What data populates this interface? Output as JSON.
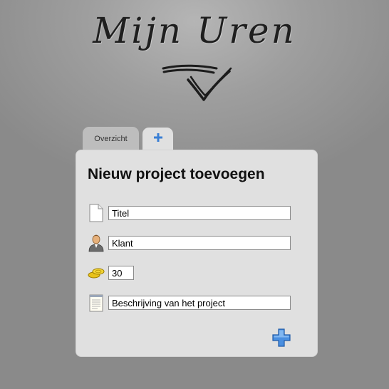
{
  "header": {
    "logo_text": "Mijn Uren"
  },
  "tabs": [
    {
      "label": "Overzicht",
      "active": false
    },
    {
      "label": "+",
      "icon": "plus-icon",
      "active": true
    }
  ],
  "form": {
    "title": "Nieuw project toevoegen",
    "fields": [
      {
        "icon": "document-icon",
        "value": "Titel"
      },
      {
        "icon": "user-icon",
        "value": "Klant"
      },
      {
        "icon": "coins-icon",
        "value": "30"
      },
      {
        "icon": "notepad-icon",
        "value": "Beschrijving van het project"
      }
    ],
    "submit_icon": "add-plus-icon"
  },
  "colors": {
    "accent": "#3a7fd5",
    "panel": "#e0e0e0",
    "background": "#9a9a9a"
  }
}
